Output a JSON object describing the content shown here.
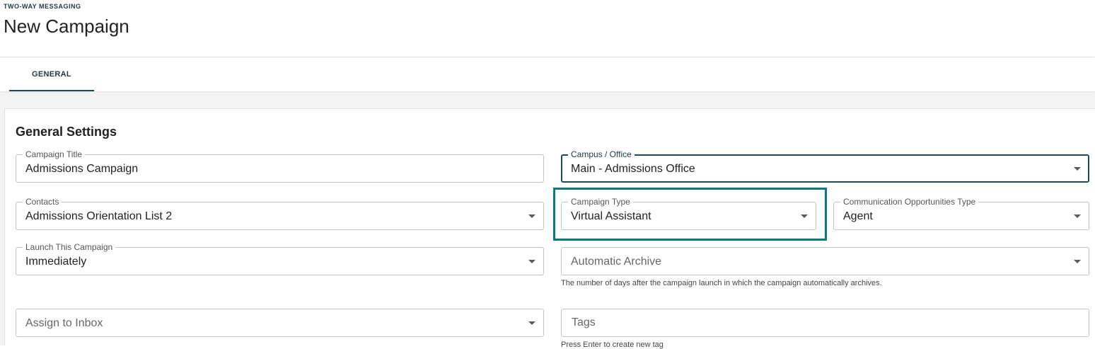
{
  "header": {
    "eyebrow": "TWO-WAY MESSAGING",
    "title": "New Campaign"
  },
  "tabs": [
    {
      "label": "GENERAL",
      "active": true
    }
  ],
  "section": {
    "title": "General Settings"
  },
  "fields": {
    "campaign_title": {
      "label": "Campaign Title",
      "value": "Admissions Campaign"
    },
    "campus_office": {
      "label": "Campus / Office",
      "value": "Main - Admissions Office"
    },
    "contacts": {
      "label": "Contacts",
      "value": "Admissions Orientation List 2"
    },
    "campaign_type": {
      "label": "Campaign Type",
      "value": "Virtual Assistant"
    },
    "comm_opp_type": {
      "label": "Communication Opportunities Type",
      "value": "Agent"
    },
    "launch": {
      "label": "Launch This Campaign",
      "value": "Immediately"
    },
    "auto_archive": {
      "placeholder": "Automatic Archive",
      "helper": "The number of days after the campaign launch in which the campaign automatically archives."
    },
    "assign_inbox": {
      "placeholder": "Assign to Inbox"
    },
    "tags": {
      "placeholder": "Tags",
      "helper": "Press Enter to create new tag"
    }
  },
  "colors": {
    "accent": "#1e4a52",
    "highlight": "#0e7a80"
  }
}
